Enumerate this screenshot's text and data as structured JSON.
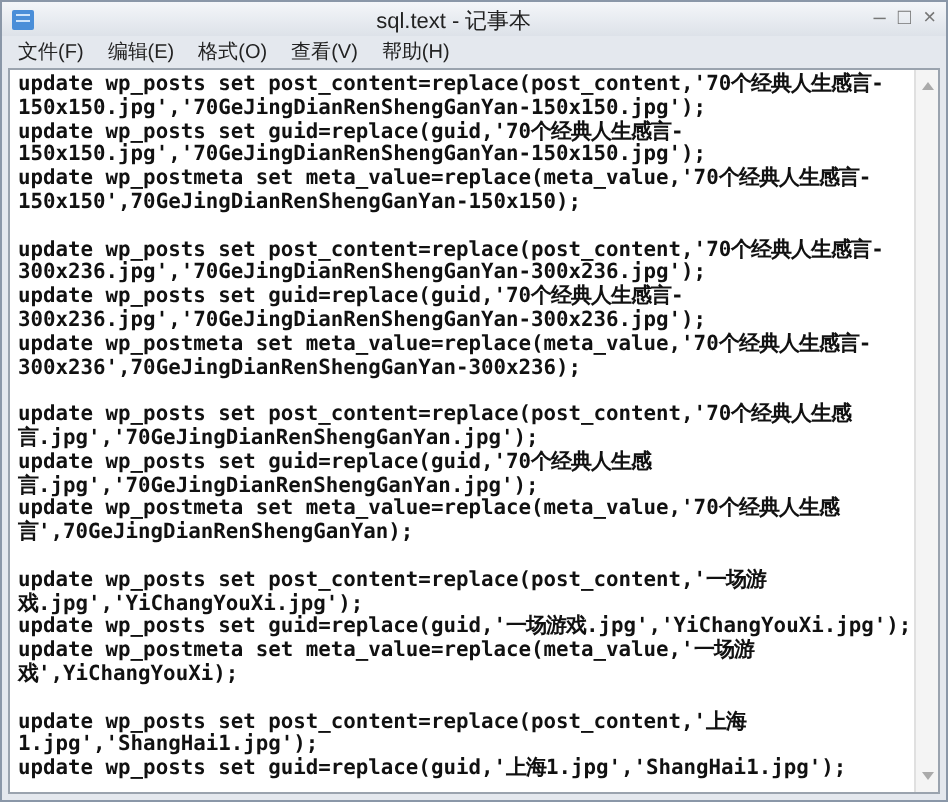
{
  "window": {
    "title": "sql.text - 记事本",
    "controls": [
      "–",
      "□",
      "×"
    ]
  },
  "menu": [
    "文件(F)",
    "编辑(E)",
    "格式(O)",
    "查看(V)",
    "帮助(H)"
  ],
  "editor": {
    "blocks": [
      [
        "update wp_posts set post_content=replace(post_content,'70个经典人生感言-",
        "150x150.jpg','70GeJingDianRenShengGanYan-150x150.jpg');",
        "update wp_posts set guid=replace(guid,'70个经典人生感言-",
        "150x150.jpg','70GeJingDianRenShengGanYan-150x150.jpg');",
        "update wp_postmeta set meta_value=replace(meta_value,'70个经典人生感言-",
        "150x150',70GeJingDianRenShengGanYan-150x150);"
      ],
      [
        "update wp_posts set post_content=replace(post_content,'70个经典人生感言-",
        "300x236.jpg','70GeJingDianRenShengGanYan-300x236.jpg');",
        "update wp_posts set guid=replace(guid,'70个经典人生感言-",
        "300x236.jpg','70GeJingDianRenShengGanYan-300x236.jpg');",
        "update wp_postmeta set meta_value=replace(meta_value,'70个经典人生感言-",
        "300x236',70GeJingDianRenShengGanYan-300x236);"
      ],
      [
        "update wp_posts set post_content=replace(post_content,'70个经典人生感",
        "言.jpg','70GeJingDianRenShengGanYan.jpg');",
        "update wp_posts set guid=replace(guid,'70个经典人生感",
        "言.jpg','70GeJingDianRenShengGanYan.jpg');",
        "update wp_postmeta set meta_value=replace(meta_value,'70个经典人生感",
        "言',70GeJingDianRenShengGanYan);"
      ],
      [
        "update wp_posts set post_content=replace(post_content,'一场游",
        "戏.jpg','YiChangYouXi.jpg');",
        "update wp_posts set guid=replace(guid,'一场游戏.jpg','YiChangYouXi.jpg');",
        "update wp_postmeta set meta_value=replace(meta_value,'一场游",
        "戏',YiChangYouXi);"
      ],
      [
        "update wp_posts set post_content=replace(post_content,'上海",
        "1.jpg','ShangHai1.jpg');",
        "update wp_posts set guid=replace(guid,'上海1.jpg','ShangHai1.jpg');"
      ]
    ]
  }
}
